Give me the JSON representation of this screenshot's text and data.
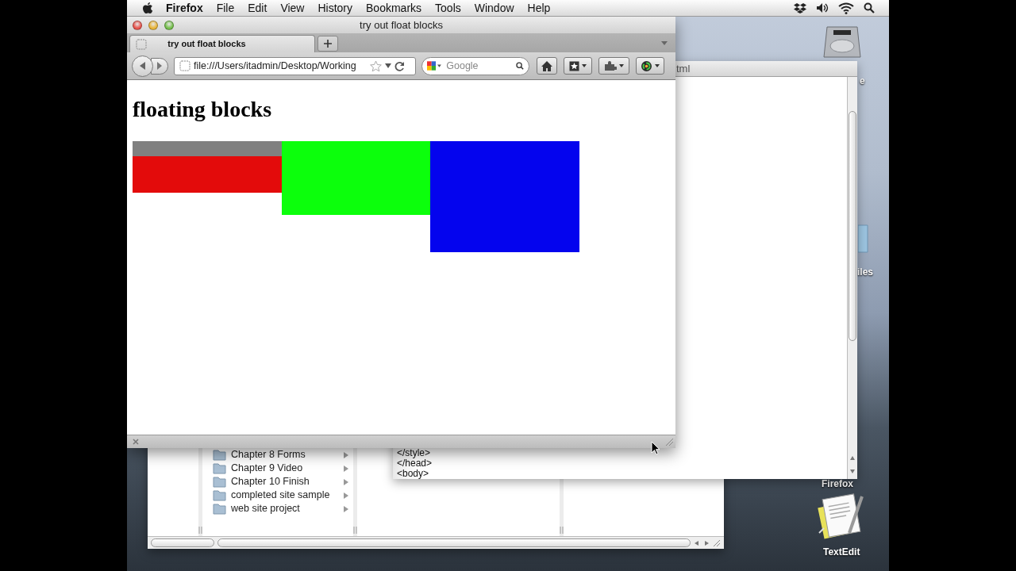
{
  "menu_bar": {
    "app_name": "Firefox",
    "items": [
      "File",
      "Edit",
      "View",
      "History",
      "Bookmarks",
      "Tools",
      "Window",
      "Help"
    ]
  },
  "browser": {
    "title": "try out float blocks",
    "tabs": [
      {
        "label": "try out float blocks",
        "selected": true
      }
    ],
    "address": "file:///Users/itadmin/Desktop/Working",
    "search_placeholder": "Google",
    "page": {
      "heading": "floating blocks",
      "blocks": [
        {
          "color": "#808080"
        },
        {
          "color": "#e30b0b"
        },
        {
          "color": "#0cff0c"
        },
        {
          "color": "#0404ee"
        }
      ]
    }
  },
  "text_editor": {
    "title": "tml",
    "lines": [
      "</style>",
      "</head>",
      "<body>"
    ]
  },
  "finder": {
    "items": [
      "Chapter 8 Forms",
      "Chapter 9 Video",
      "Chapter 10 Finish",
      "completed site sample",
      "web site project"
    ]
  },
  "desktop": {
    "icons": [
      {
        "kind": "drive",
        "label": "e"
      },
      {
        "kind": "folder",
        "label": "iles"
      },
      {
        "kind": "covered",
        "label": "Firefox"
      },
      {
        "kind": "document",
        "label": "TextEdit"
      }
    ]
  }
}
